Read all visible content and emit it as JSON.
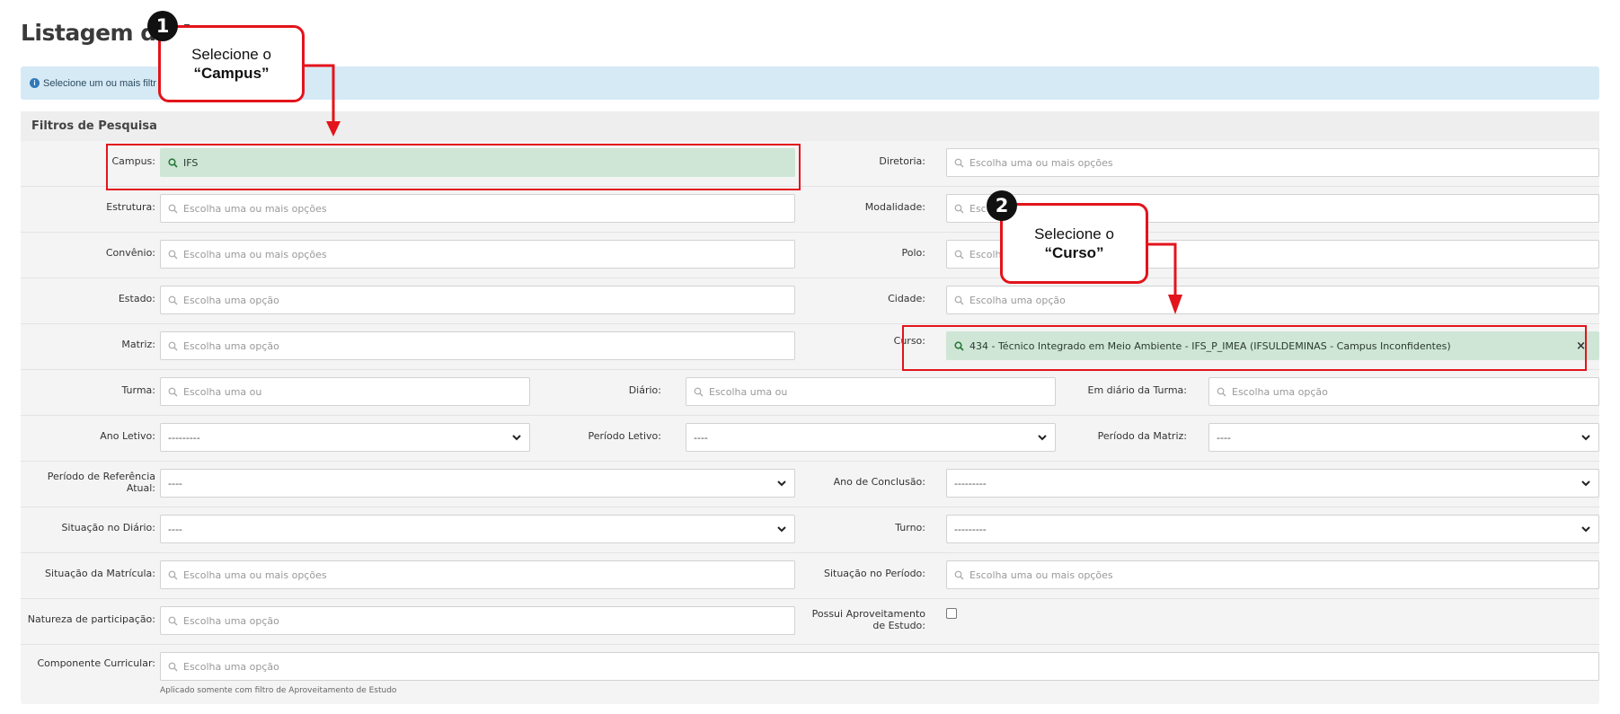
{
  "page": {
    "title": "Listagem de A"
  },
  "info": {
    "text": "Selecione um ou mais filtr"
  },
  "filters": {
    "header": "Filtros de Pesquisa",
    "campus": {
      "label": "Campus:",
      "value": "IFS"
    },
    "diretoria": {
      "label": "Diretoria:",
      "placeholder": "Escolha uma ou mais opções"
    },
    "estrutura": {
      "label": "Estrutura:",
      "placeholder": "Escolha uma ou mais opções"
    },
    "modalidade": {
      "label": "Modalidade:",
      "placeholder": "Esco"
    },
    "convenio": {
      "label": "Convênio:",
      "placeholder": "Escolha uma ou mais opções"
    },
    "polo": {
      "label": "Polo:",
      "placeholder": "Escolh"
    },
    "estado": {
      "label": "Estado:",
      "placeholder": "Escolha uma opção"
    },
    "cidade": {
      "label": "Cidade:",
      "placeholder": "Escolha uma opção"
    },
    "matriz": {
      "label": "Matriz:",
      "placeholder": "Escolha uma opção"
    },
    "curso": {
      "label": "Curso:",
      "value": "434 - Técnico Integrado em Meio Ambiente - IFS_P_IMEA (IFSULDEMINAS - Campus Inconfidentes)",
      "clear": "×"
    },
    "turma": {
      "label": "Turma:",
      "placeholder": "Escolha uma ou"
    },
    "diario": {
      "label": "Diário:",
      "placeholder": "Escolha uma ou"
    },
    "em_diario_turma": {
      "label": "Em diário da Turma:",
      "placeholder": "Escolha uma opção"
    },
    "ano_letivo": {
      "label": "Ano Letivo:",
      "value": "---------"
    },
    "periodo_letivo": {
      "label": "Período Letivo:",
      "value": "----"
    },
    "periodo_matriz": {
      "label": "Período da Matriz:",
      "value": "----"
    },
    "periodo_ref": {
      "label_line1": "Período de Referência",
      "label_line2": "Atual:",
      "value": "----"
    },
    "ano_conclusao": {
      "label": "Ano de Conclusão:",
      "value": "---------"
    },
    "situacao_diario": {
      "label": "Situação no Diário:",
      "value": "----"
    },
    "turno": {
      "label": "Turno:",
      "value": "---------"
    },
    "situacao_matricula": {
      "label": "Situação da Matrícula:",
      "placeholder": "Escolha uma ou mais opções"
    },
    "situacao_periodo": {
      "label": "Situação no Período:",
      "placeholder": "Escolha uma ou mais opções"
    },
    "natureza": {
      "label": "Natureza de participação:",
      "placeholder": "Escolha uma opção"
    },
    "aproveitamento": {
      "label_line1": "Possui Aproveitamento",
      "label_line2": "de Estudo:"
    },
    "componente": {
      "label": "Componente Curricular:",
      "placeholder": "Escolha uma opção",
      "helper": "Aplicado somente com filtro de Aproveitamento de Estudo"
    }
  },
  "annotations": {
    "step1": {
      "number": "1",
      "line1": "Selecione o",
      "line2": "“Campus”"
    },
    "step2": {
      "number": "2",
      "line1": "Selecione o",
      "line2": "“Curso”"
    },
    "color": "#e3141b"
  }
}
